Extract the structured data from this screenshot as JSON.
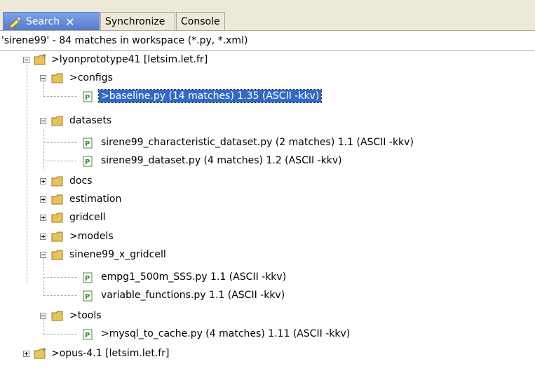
{
  "tabs": [
    {
      "label": "Search",
      "active": true
    },
    {
      "label": "Synchronize",
      "active": false
    },
    {
      "label": "Console",
      "active": false
    }
  ],
  "summary": "'sirene99' - 84 matches in workspace (*.py, *.xml)",
  "tree": {
    "project1": {
      "label": ">lyonprototype41   [letsim.let.fr]"
    },
    "configs": {
      "label": ">configs"
    },
    "baseline": {
      "label": ">baseline.py (14 matches)  1.35  (ASCII -kkv)"
    },
    "datasets": {
      "label": "datasets"
    },
    "characteristic": {
      "label": "sirene99_characteristic_dataset.py (2 matches)  1.1  (ASCII -kkv)"
    },
    "dataset": {
      "label": "sirene99_dataset.py (4 matches)  1.2  (ASCII -kkv)"
    },
    "docs": {
      "label": "docs"
    },
    "estimation": {
      "label": "estimation"
    },
    "gridcell": {
      "label": "gridcell"
    },
    "models": {
      "label": ">models"
    },
    "sinene": {
      "label": "sinene99_x_gridcell"
    },
    "empg": {
      "label": "empg1_500m_SSS.py  1.1  (ASCII -kkv)"
    },
    "variable": {
      "label": "variable_functions.py  1.1  (ASCII -kkv)"
    },
    "tools": {
      "label": ">tools"
    },
    "mysql": {
      "label": ">mysql_to_cache.py (4 matches)  1.11  (ASCII -kkv)"
    },
    "project2": {
      "label": ">opus-4.1   [letsim.let.fr]"
    }
  },
  "colors": {
    "selection": "#316ac5",
    "active_tab": "#5479cc",
    "folder": "#e8c25a",
    "python_file": "#3c8c3c"
  }
}
